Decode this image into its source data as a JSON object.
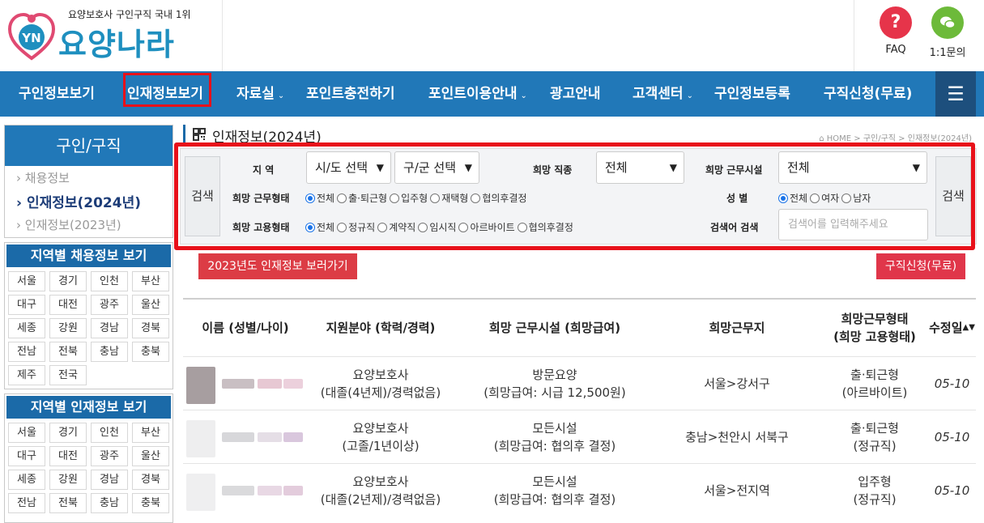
{
  "header": {
    "tagline": "요양보호사 구인구직 국내 1위",
    "logo_mark_text": "YN",
    "logo_text": "요양나라",
    "faq": {
      "icon": "question-icon",
      "label": "FAQ",
      "color": "#e6344a"
    },
    "inquiry": {
      "icon": "chat-icon",
      "label": "1:1문의",
      "color": "#6dba3a"
    }
  },
  "nav": {
    "items": [
      {
        "label": "구인정보보기",
        "caret": false
      },
      {
        "label": "인재정보보기",
        "caret": false
      },
      {
        "label": "자료실",
        "caret": true
      },
      {
        "label": "포인트충전하기",
        "caret": false
      },
      {
        "label": "포인트이용안내",
        "caret": true
      },
      {
        "label": "광고안내",
        "caret": false
      },
      {
        "label": "고객센터",
        "caret": true
      },
      {
        "label": "구인정보등록",
        "caret": false
      },
      {
        "label": "구직신청(무료)",
        "caret": false
      }
    ],
    "menu_icon": "hamburger-icon",
    "bg_color": "#2178b8"
  },
  "sidebar": {
    "title": "구인/구직",
    "items": [
      {
        "label": "채용정보",
        "active": false
      },
      {
        "label": "인재정보(2024년)",
        "active": true
      },
      {
        "label": "인재정보(2023년)",
        "active": false
      }
    ],
    "region_jobs": {
      "title": "지역별 채용정보 보기",
      "regions": [
        "서울",
        "경기",
        "인천",
        "부산",
        "대구",
        "대전",
        "광주",
        "울산",
        "세종",
        "강원",
        "경남",
        "경북",
        "전남",
        "전북",
        "충남",
        "충북",
        "제주",
        "전국"
      ]
    },
    "region_talent": {
      "title": "지역별 인재정보 보기",
      "regions": [
        "서울",
        "경기",
        "인천",
        "부산",
        "대구",
        "대전",
        "광주",
        "울산",
        "세종",
        "강원",
        "경남",
        "경북",
        "전남",
        "전북",
        "충남",
        "충북"
      ]
    }
  },
  "main": {
    "title": "인재정보(2024년)",
    "breadcrumb": "HOME > 구인/구직 > 인재정보(2024년)"
  },
  "search": {
    "button_label": "검색",
    "region_label": "지 역",
    "region_sido": "시/도 선택",
    "region_gugun": "구/군 선택",
    "job_label": "희망 직종",
    "job_value": "전체",
    "facility_label": "희망 근무시설",
    "facility_value": "전체",
    "work_type_label": "희망 근무형태",
    "work_type_options": [
      {
        "label": "전체",
        "checked": true
      },
      {
        "label": "출·퇴근형",
        "checked": false
      },
      {
        "label": "입주형",
        "checked": false
      },
      {
        "label": "재택형",
        "checked": false
      },
      {
        "label": "협의후결정",
        "checked": false
      }
    ],
    "gender_label": "성 별",
    "gender_options": [
      {
        "label": "전체",
        "checked": true
      },
      {
        "label": "여자",
        "checked": false
      },
      {
        "label": "남자",
        "checked": false
      }
    ],
    "employment_label": "희망 고용형태",
    "employment_options": [
      {
        "label": "전체",
        "checked": true
      },
      {
        "label": "정규직",
        "checked": false
      },
      {
        "label": "계약직",
        "checked": false
      },
      {
        "label": "임시직",
        "checked": false
      },
      {
        "label": "아르바이트",
        "checked": false
      },
      {
        "label": "협의후결정",
        "checked": false
      }
    ],
    "keyword_label": "검색어 검색",
    "keyword_placeholder": "검색어를 입력해주세요"
  },
  "actions": {
    "view_2023": "2023년도 인재정보 보러가기",
    "apply": "구직신청(무료)"
  },
  "table": {
    "headers": {
      "name": "이름 (성별/나이)",
      "field": "지원분야 (학력/경력)",
      "facility": "희망 근무시설 (희망급여)",
      "location": "희망근무지",
      "type_line1": "희망근무형태",
      "type_line2": "(희망 고용형태)",
      "date": "수정일"
    },
    "sort_icon": "sort-icon",
    "rows": [
      {
        "field": "요양보호사",
        "edu": "(대졸(4년제)/경력없음)",
        "facility": "방문요양",
        "pay": "(희망급여: 시급 12,500원)",
        "location": "서울>강서구",
        "work_type": "출·퇴근형",
        "emp_type": "(아르바이트)",
        "date": "05-10"
      },
      {
        "field": "요양보호사",
        "edu": "(고졸/1년이상)",
        "facility": "모든시설",
        "pay": "(희망급여: 협의후 결정)",
        "location": "충남>천안시 서북구",
        "work_type": "출·퇴근형",
        "emp_type": "(정규직)",
        "date": "05-10"
      },
      {
        "field": "요양보호사",
        "edu": "(대졸(2년제)/경력없음)",
        "facility": "모든시설",
        "pay": "(희망급여: 협의후 결정)",
        "location": "서울>전지역",
        "work_type": "입주형",
        "emp_type": "(정규직)",
        "date": "05-10"
      }
    ]
  }
}
